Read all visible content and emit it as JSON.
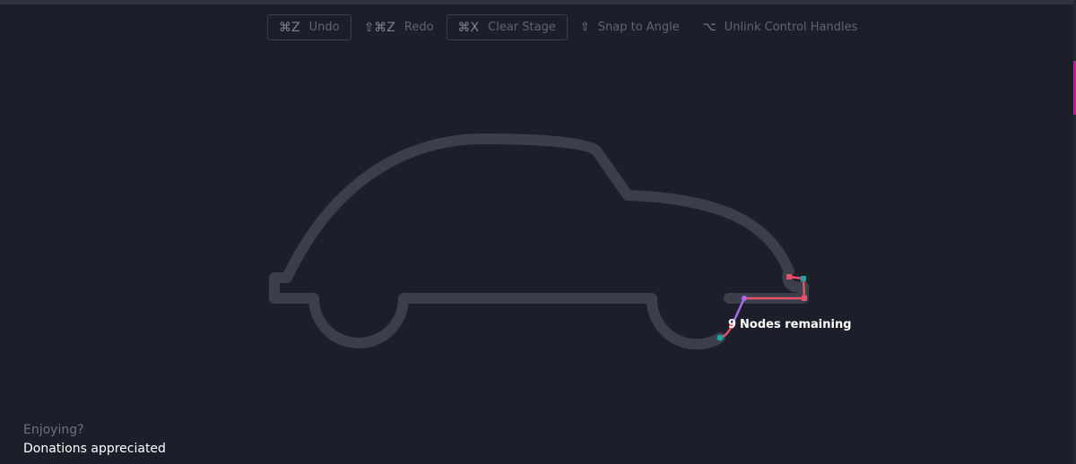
{
  "toolbar": {
    "undo": {
      "key": "⌘Z",
      "label": "Undo"
    },
    "redo": {
      "key": "⇧⌘Z",
      "label": "Redo"
    },
    "clear": {
      "key": "⌘X",
      "label": "Clear Stage"
    },
    "snap": {
      "key": "⇧",
      "label": "Snap to Angle"
    },
    "unlink": {
      "key": "⌥",
      "label": "Unlink Control Handles"
    }
  },
  "status": {
    "nodes_count": "9",
    "nodes_text": "Nodes remaining"
  },
  "footer": {
    "line1": "Enjoying?",
    "line2": "Donations appreciated"
  },
  "colors": {
    "background": "#1c1f29",
    "outline": "#3b3f4a",
    "node_red": "#e8506b",
    "node_teal": "#1fa2a0",
    "node_purple": "#a86bea"
  },
  "icons": [
    "command-icon",
    "shift-icon",
    "option-icon"
  ]
}
